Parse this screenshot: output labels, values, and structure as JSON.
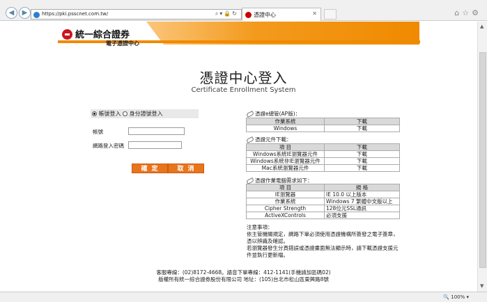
{
  "browser": {
    "url": "https://pki.psscnet.com.tw/",
    "tab_title": "憑證中心",
    "zoom": "100%"
  },
  "logo": {
    "company": "統一綜合證券",
    "subtitle": "電子憑證中心"
  },
  "page": {
    "title": "憑證中心登入",
    "subtitle": "Certificate Enrollment System"
  },
  "login": {
    "options": [
      "帳號登入",
      "身分證號登入"
    ],
    "selected": "帳號登入",
    "account_label": "帳號",
    "password_label": "網路登入密碼",
    "confirm": "確定",
    "cancel": "取消"
  },
  "section_ap": {
    "heading": "憑證e總管(AP版)：",
    "headers": [
      "作業系統",
      "下載"
    ],
    "rows": [
      [
        "Windows",
        "下載"
      ]
    ]
  },
  "section_components": {
    "heading": "憑證元件下載：",
    "headers": [
      "項 目",
      "下載"
    ],
    "rows": [
      [
        "Windows系統IE瀏覽器元件",
        "下載"
      ],
      [
        "Windows系統非IE瀏覽器元件",
        "下載"
      ],
      [
        "Mac系統瀏覽器元件",
        "下載"
      ]
    ]
  },
  "section_requirements": {
    "heading": "憑證作業電腦需求如下：",
    "headers": [
      "項 目",
      "規 格"
    ],
    "rows": [
      [
        "IE瀏覽器",
        "IE 10.0 以上版本"
      ],
      [
        "作業系統",
        "Windows 7 繁體中文版以上"
      ],
      [
        "Cipher Strength",
        "128位元SSL通訊"
      ],
      [
        "ActiveXControls",
        "必須支援"
      ]
    ]
  },
  "notes": {
    "heading": "注意事項：",
    "line1": "依主管機關規定，網路下單必須使用憑證機構所簽發之電子簽章，憑以辨識及確認。",
    "line2": "若瀏覽器發生分頁錯誤或憑證畫面無法顯示時，請下載憑證支援元件並執行更新檔。"
  },
  "footer": {
    "line1": "客服專線：(02)8172-4668。語音下單專線：412-1141(手機請加區碼02)",
    "line2": "版權所有統一綜合證券股份有限公司 地址：(105)台北市松山區東興路8號"
  }
}
